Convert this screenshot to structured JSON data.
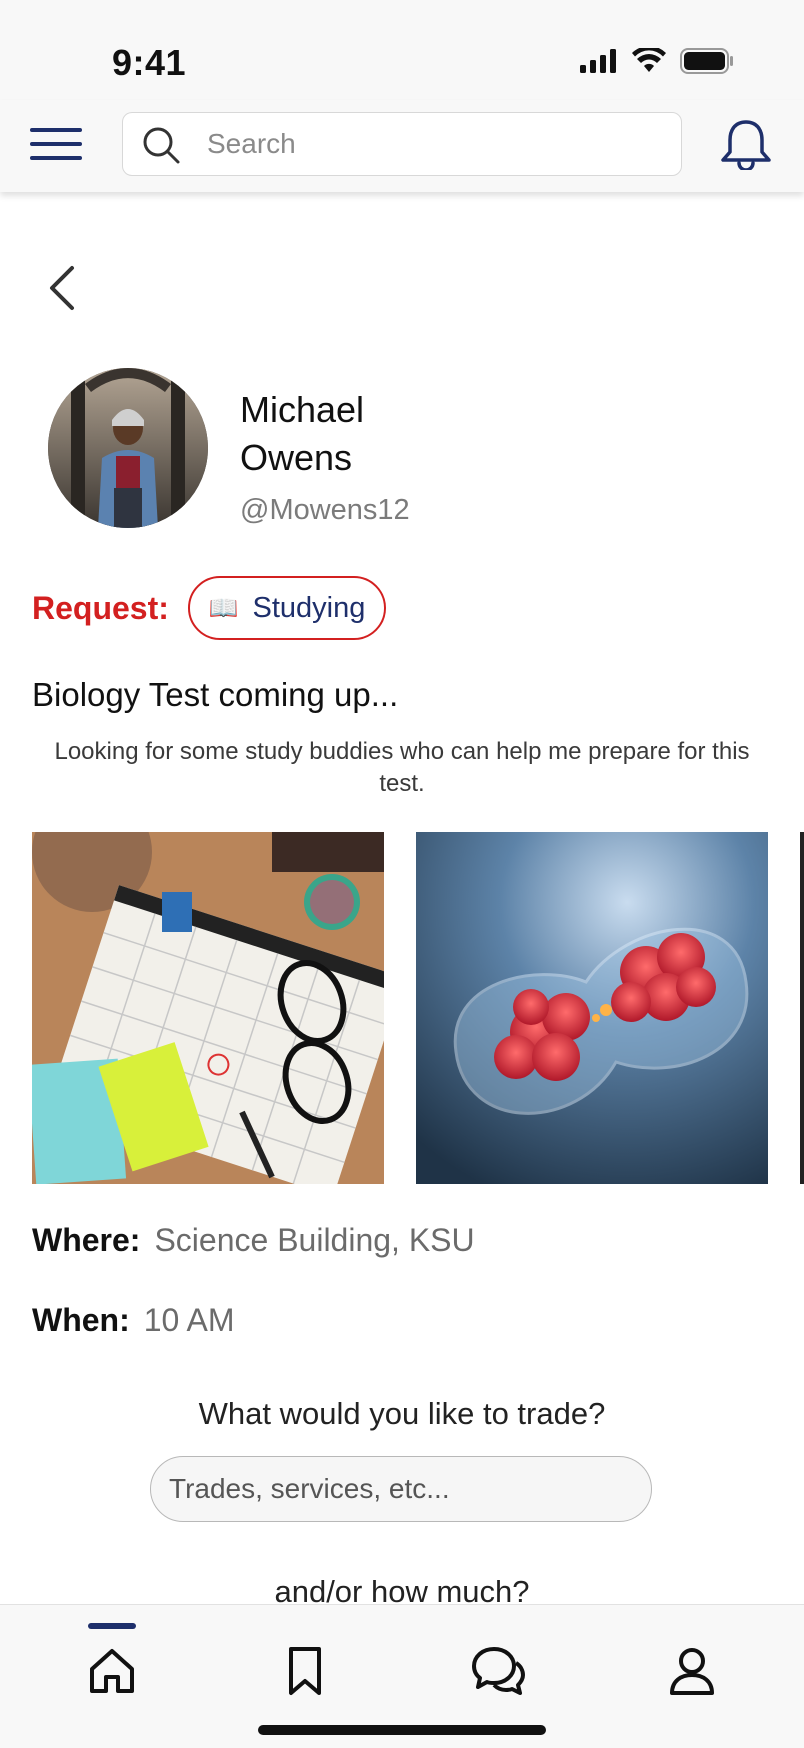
{
  "status_bar": {
    "time": "9:41",
    "icons": [
      "cellular-signal-icon",
      "wifi-icon",
      "battery-icon"
    ]
  },
  "header": {
    "menu_icon": "hamburger-menu-icon",
    "search_placeholder": "Search",
    "bell_icon": "bell-icon"
  },
  "colors": {
    "brand_navy": "#1e2f6b",
    "request_red": "#d32020"
  },
  "profile": {
    "first_name": "Michael",
    "last_name": "Owens",
    "handle": "@Mowens12"
  },
  "request": {
    "label": "Request:",
    "chip_emoji": "📖",
    "chip_label": "Studying"
  },
  "post": {
    "title": "Biology Test coming up...",
    "description": "Looking for some study buddies who can help me prepare for this test."
  },
  "details": {
    "where_label": "Where:",
    "where_value": "Science Building, KSU",
    "when_label": "When:",
    "when_value": "10 AM"
  },
  "trade": {
    "question": "What would you like to trade?",
    "placeholder": "Trades, services, etc...",
    "price_question": "and/or how much?"
  },
  "tab_bar": {
    "tabs": [
      "home-icon",
      "bookmark-icon",
      "chat-icon",
      "profile-icon"
    ],
    "active": "home-icon"
  }
}
